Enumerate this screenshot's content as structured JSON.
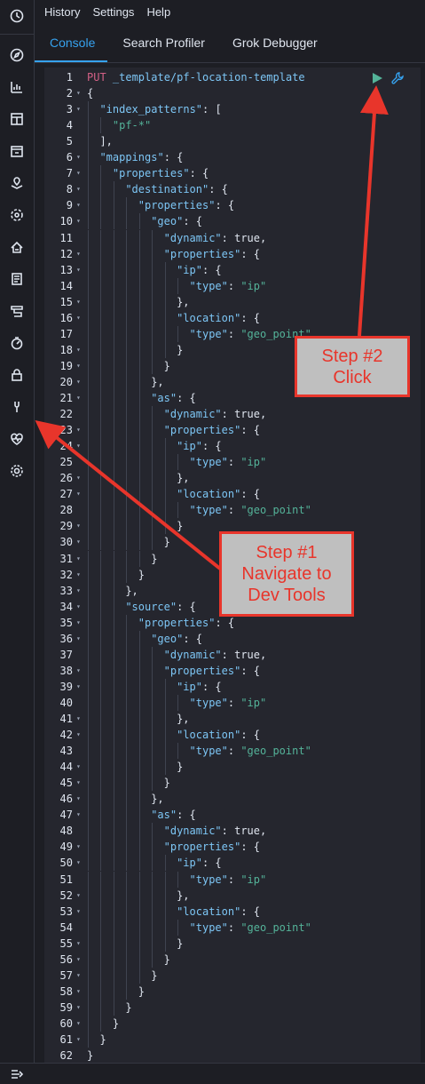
{
  "nav": {
    "items": [
      "History",
      "Settings",
      "Help"
    ]
  },
  "tabs": [
    "Console",
    "Search Profiler",
    "Grok Debugger"
  ],
  "sidebar": {
    "icons": [
      "clock-icon",
      "discover-icon",
      "visualize-icon",
      "dashboard-icon",
      "canvas-icon",
      "maps-icon",
      "ml-icon",
      "infrastructure-icon",
      "logs-icon",
      "apm-icon",
      "uptime-icon",
      "siem-icon",
      "dev-tools-icon",
      "monitoring-icon",
      "management-icon"
    ],
    "collapse_icon": "collapse-icon"
  },
  "editor": {
    "request_line": "PUT _template/pf-location-template",
    "lines": [
      "{",
      "  \"index_patterns\": [",
      "    \"pf-*\"",
      "  ],",
      "  \"mappings\": {",
      "    \"properties\": {",
      "      \"destination\": {",
      "        \"properties\": {",
      "          \"geo\": {",
      "            \"dynamic\": true,",
      "            \"properties\": {",
      "              \"ip\": {",
      "                \"type\": \"ip\"",
      "              },",
      "              \"location\": {",
      "                \"type\": \"geo_point\"",
      "              }",
      "            }",
      "          },",
      "          \"as\": {",
      "            \"dynamic\": true,",
      "            \"properties\": {",
      "              \"ip\": {",
      "                \"type\": \"ip\"",
      "              },",
      "              \"location\": {",
      "                \"type\": \"geo_point\"",
      "              }",
      "            }",
      "          }",
      "        }",
      "      },",
      "      \"source\": {",
      "        \"properties\": {",
      "          \"geo\": {",
      "            \"dynamic\": true,",
      "            \"properties\": {",
      "              \"ip\": {",
      "                \"type\": \"ip\"",
      "              },",
      "              \"location\": {",
      "                \"type\": \"geo_point\"",
      "              }",
      "            }",
      "          },",
      "          \"as\": {",
      "            \"dynamic\": true,",
      "            \"properties\": {",
      "              \"ip\": {",
      "                \"type\": \"ip\"",
      "              },",
      "              \"location\": {",
      "                \"type\": \"geo_point\"",
      "              }",
      "            }",
      "          }",
      "        }",
      "      }",
      "    }",
      "  }",
      "}"
    ],
    "fold_lines": [
      2,
      3,
      6,
      7,
      8,
      9,
      10,
      12,
      13,
      15,
      16,
      18,
      19,
      20,
      21,
      23,
      24,
      26,
      27,
      29,
      30,
      31,
      32,
      33,
      34,
      35,
      36,
      38,
      39,
      41,
      42,
      44,
      45,
      46,
      47,
      49,
      50,
      52,
      53,
      55,
      56,
      57,
      58,
      59,
      60,
      61
    ],
    "run_icon": "play-icon",
    "settings_icon": "wrench-icon"
  },
  "annotations": {
    "step1": [
      "Step #1",
      "Navigate to",
      "Dev Tools"
    ],
    "step2": [
      "Step #2",
      "Click"
    ],
    "color": "#e8352b"
  },
  "colors": {
    "active_tab": "#36a2ef",
    "keyword": "#7dc6f5",
    "string": "#54b399",
    "method": "#d36086"
  }
}
